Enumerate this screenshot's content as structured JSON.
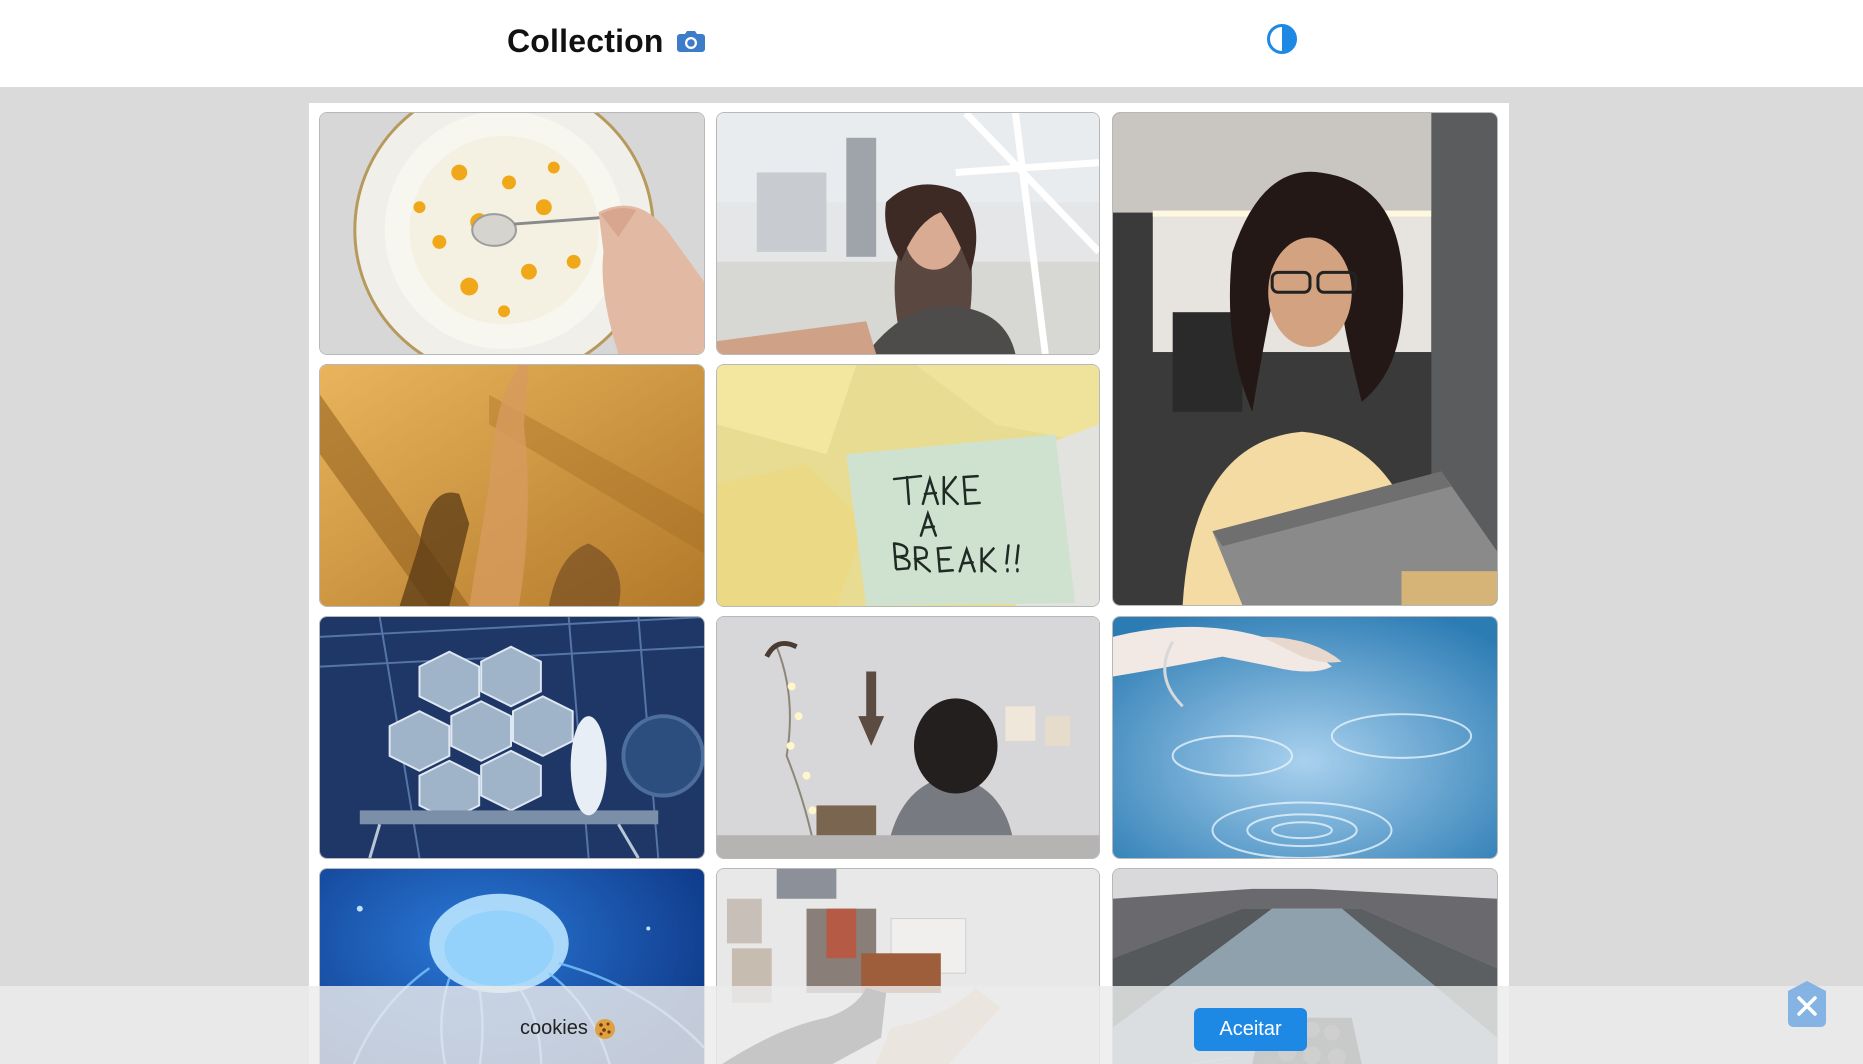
{
  "header": {
    "title": "Collection",
    "title_icon": "camera-icon",
    "theme_toggle_icon": "contrast-icon"
  },
  "gallery": {
    "tiles": [
      {
        "id": "plate-flowers",
        "desc": "hand stirring plate with yellow petals"
      },
      {
        "id": "woman-hair-wind",
        "desc": "woman with windswept hair"
      },
      {
        "id": "woman-laptop",
        "desc": "woman with curly hair at laptop"
      },
      {
        "id": "shadow-hands",
        "desc": "hand shadow on amber wall"
      },
      {
        "id": "take-a-break",
        "desc": "sticky note among yellow papers"
      },
      {
        "id": "hexagon-mirror",
        "desc": "hexagonal telescope mirror"
      },
      {
        "id": "woman-wall",
        "desc": "person facing wall with lights"
      },
      {
        "id": "hand-water",
        "desc": "hand over blue water ripples"
      },
      {
        "id": "jellyfish",
        "desc": "blue jellyfish"
      },
      {
        "id": "photos-wall",
        "desc": "hands pinning photos to wall"
      },
      {
        "id": "canal-boat",
        "desc": "boat on city canal"
      }
    ]
  },
  "cookie_banner": {
    "text": "cookies",
    "icon": "cookie-icon",
    "accept_label": "Aceitar",
    "close_icon": "close-icon"
  },
  "colors": {
    "accent": "#1e88e5",
    "page_bg": "#dadada"
  }
}
